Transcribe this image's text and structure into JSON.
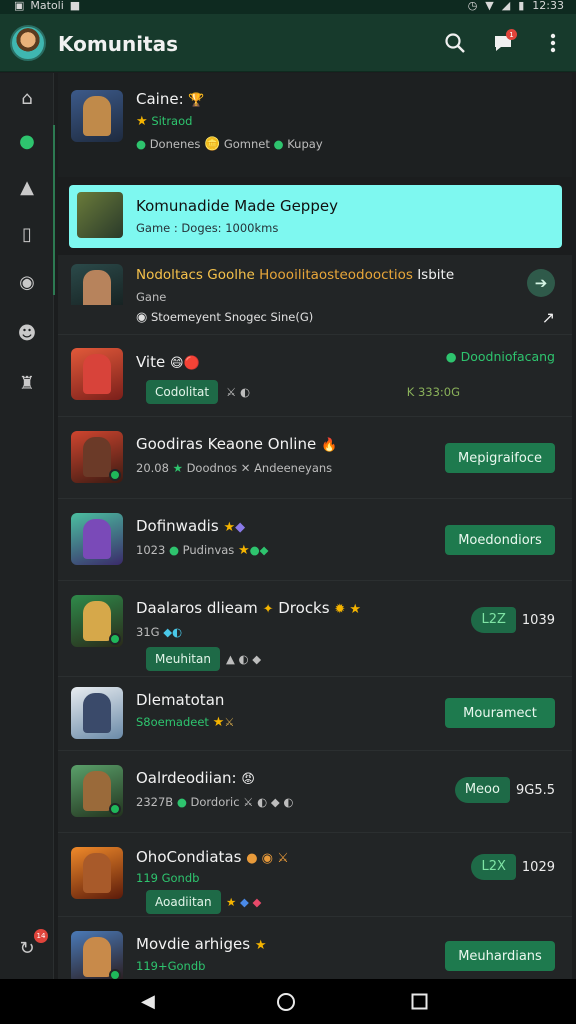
{
  "status": {
    "carrier": "Matoli",
    "time": "12:33"
  },
  "appbar": {
    "title": "Komunitas",
    "chat_badge": "1"
  },
  "rail": {
    "bottom_badge": "14"
  },
  "colors": {
    "accent": "#2ec46e",
    "appbar": "#173a2c",
    "highlight": "#7ef8f0",
    "button": "#1e7a4e"
  },
  "header_row": {
    "name": "Caine:",
    "sub": "Sitraod",
    "meta_a": "Donenes",
    "meta_b": "Gomnet",
    "meta_c": "Kupay"
  },
  "highlight": {
    "name": "Komunadide Made Geppey",
    "sub": "Game : Doges: 1000kms"
  },
  "feature": {
    "name_a": "Nodoltacs Goolhe",
    "name_b": "Hoooilitaosteodooctios",
    "name_c": "Isbite",
    "sub": "Gane",
    "caption": "Stoemeyent Snogec Sine(G)"
  },
  "rows": [
    {
      "name": "Vite",
      "pill": "Codolitat",
      "right_label": "Doodniofacang",
      "right_meta": "K 333:0G"
    },
    {
      "name": "Goodiras Keaone Online",
      "sub_a": "20.08",
      "sub_b": "Doodnos",
      "sub_c": "Andeeneyans",
      "button": "Mepigraifoce"
    },
    {
      "name": "Dofinwadis",
      "sub_a": "1023",
      "sub_b": "Pudinvas",
      "button": "Moedondiors"
    },
    {
      "name": "Daalaros dlieam",
      "name_b": "Drocks",
      "sub_a": "31G",
      "pill": "Meuhitan",
      "split_a": "L2Z",
      "split_b": "1039"
    },
    {
      "name": "Dlematotan",
      "sub_a": "S8oemadeet",
      "button": "Mouramect"
    },
    {
      "name": "Oalrdeodiian:",
      "sub_a": "2327B",
      "sub_b": "Dordoric",
      "split_a": "Meoo",
      "split_b": "9G5.5"
    },
    {
      "name": "OhoCondiatas",
      "sub_a": "119 Gondb",
      "pill": "Aoadiitan",
      "split_a": "L2X",
      "split_b": "1029"
    },
    {
      "name": "Movdie arhiges",
      "sub_a": "119+Gondb",
      "button": "Meuhardians"
    }
  ]
}
